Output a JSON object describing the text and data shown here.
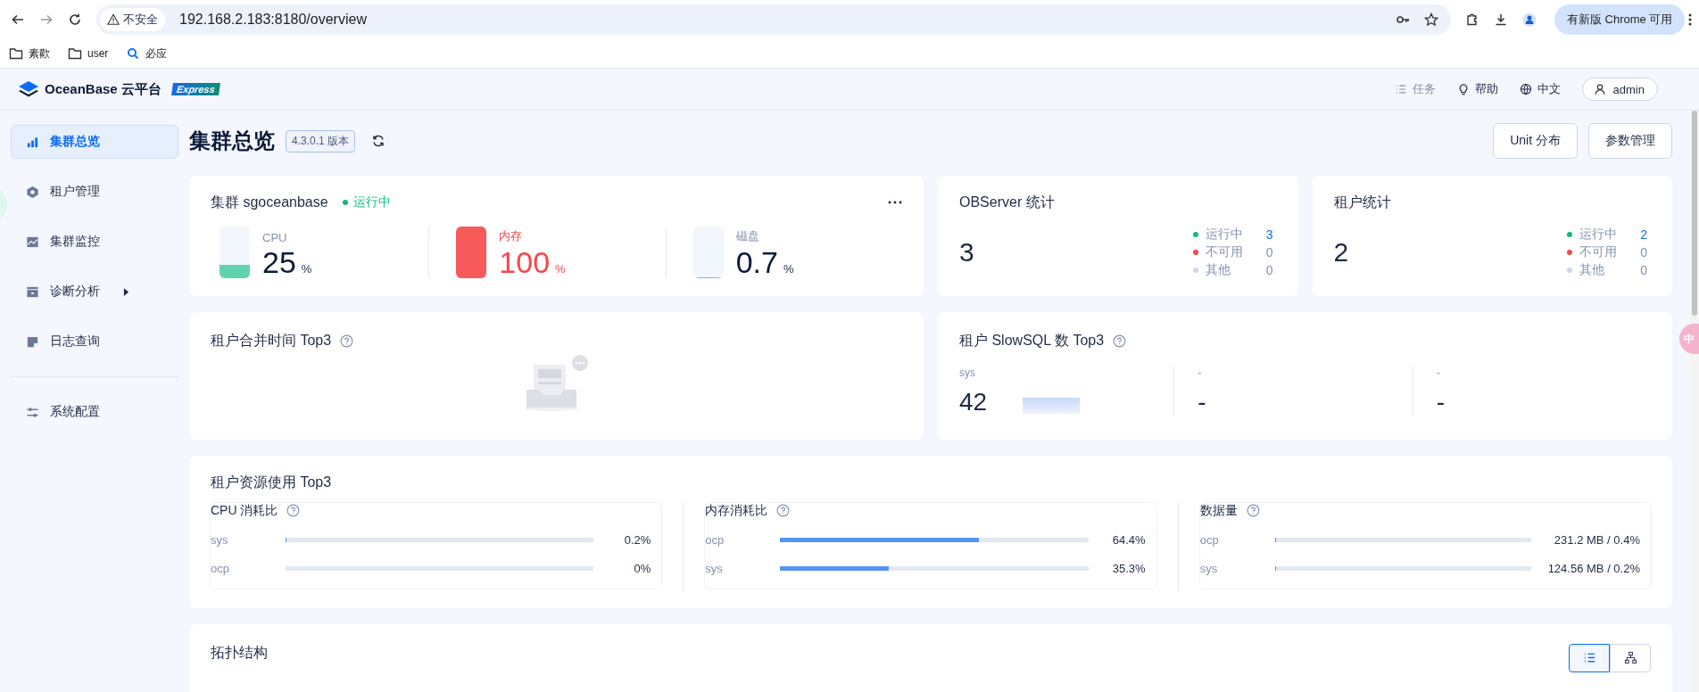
{
  "browser": {
    "security_label": "不安全",
    "url": "192.168.2.183:8180/overview",
    "update_button": "有新版 Chrome 可用"
  },
  "bookmarks": [
    {
      "label": "素歡",
      "kind": "folder"
    },
    {
      "label": "user",
      "kind": "folder"
    },
    {
      "label": "必应",
      "kind": "search"
    }
  ],
  "app_header": {
    "brand": "OceanBase 云平台",
    "badge": "Express",
    "links": [
      {
        "label": "任务",
        "kind": "tasks",
        "disabled": true
      },
      {
        "label": "帮助",
        "kind": "help",
        "disabled": false
      },
      {
        "label": "中文",
        "kind": "language",
        "disabled": false
      }
    ],
    "user": "admin"
  },
  "sidebar": {
    "items": [
      {
        "label": "集群总览",
        "kind": "overview",
        "selected": true
      },
      {
        "label": "租户管理",
        "kind": "tenant",
        "selected": false
      },
      {
        "label": "集群监控",
        "kind": "monitor",
        "selected": false
      },
      {
        "label": "诊断分析",
        "kind": "diagnose",
        "selected": false,
        "has_submenu": true
      },
      {
        "label": "日志查询",
        "kind": "log",
        "selected": false
      }
    ],
    "footer_items": [
      {
        "label": "系统配置",
        "kind": "settings",
        "selected": false
      }
    ]
  },
  "page": {
    "title": "集群总览",
    "version": "4.3.0.1 版本",
    "buttons": [
      "Unit 分布",
      "参数管理"
    ]
  },
  "cluster": {
    "title": "集群 sgoceanbase",
    "status": {
      "label": "运行中",
      "color": "#13b97c"
    },
    "metrics": [
      {
        "label": "CPU",
        "value": "25",
        "unit": "%",
        "level": 0.25,
        "alert": false
      },
      {
        "label": "内存",
        "value": "100",
        "unit": "%",
        "level": 1,
        "alert": true
      },
      {
        "label": "磁盘",
        "value": "0.7",
        "unit": "%",
        "level": 0.007,
        "alert": false
      }
    ]
  },
  "stats": [
    {
      "title": "OBServer 统计",
      "total": "3",
      "items": [
        {
          "label": "运行中",
          "value": "3",
          "color": "#13b97c",
          "highlight": true
        },
        {
          "label": "不可用",
          "value": "0",
          "color": "#f5484a",
          "highlight": false
        },
        {
          "label": "其他",
          "value": "0",
          "color": "#cdd5e4",
          "highlight": false
        }
      ]
    },
    {
      "title": "租户统计",
      "total": "2",
      "items": [
        {
          "label": "运行中",
          "value": "2",
          "color": "#13b97c",
          "highlight": true
        },
        {
          "label": "不可用",
          "value": "0",
          "color": "#f5484a",
          "highlight": false
        },
        {
          "label": "其他",
          "value": "0",
          "color": "#cdd5e4",
          "highlight": false
        }
      ]
    }
  ],
  "merge_time": {
    "title": "租户合并时间 Top3"
  },
  "slow_sql": {
    "title": "租户 SlowSQL 数 Top3",
    "columns": [
      {
        "name": "sys",
        "value": "42",
        "kind": "data"
      },
      {
        "name": "-",
        "value": "-",
        "kind": "empty"
      },
      {
        "name": "-",
        "value": "-",
        "kind": "empty"
      }
    ]
  },
  "resource": {
    "title": "租户资源使用 Top3",
    "panels": [
      {
        "title": "CPU 消耗比",
        "rows": [
          {
            "name": "sys",
            "level": 0.002,
            "reading": "0.2%"
          },
          {
            "name": "ocp",
            "reading": "0%"
          }
        ]
      },
      {
        "title": "内存消耗比",
        "rows": [
          {
            "name": "ocp",
            "level": 0.644,
            "reading": "64.4%"
          },
          {
            "name": "sys",
            "level": 0.353,
            "reading": "35.3%"
          }
        ]
      },
      {
        "title": "数据量",
        "rows": [
          {
            "name": "ocp",
            "level": 0.004,
            "reading": "231.2 MB / 0.4%"
          },
          {
            "name": "sys",
            "level": 0.002,
            "reading": "124.56 MB / 0.2%"
          }
        ]
      }
    ]
  },
  "topology": {
    "title": "拓扑结构",
    "views": [
      {
        "kind": "list",
        "selected": true
      },
      {
        "kind": "tree",
        "selected": false
      }
    ]
  },
  "floating_badge": "中"
}
